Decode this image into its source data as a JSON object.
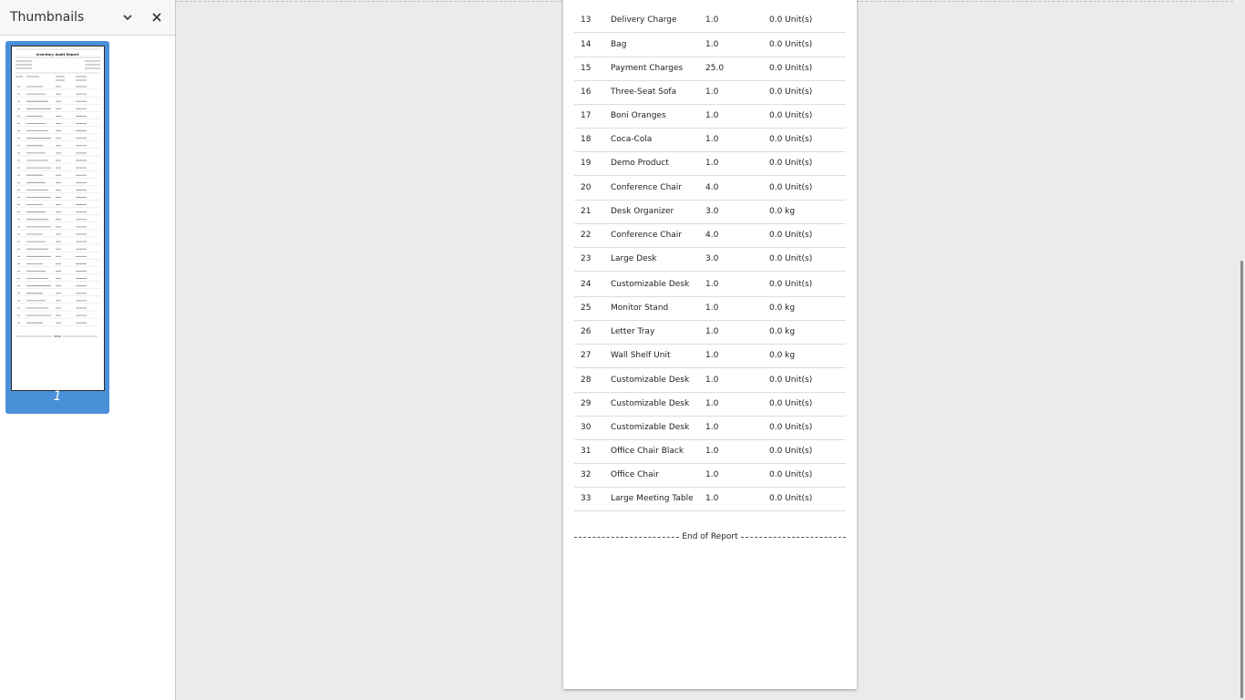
{
  "sidebar": {
    "title": "Thumbnails",
    "page_label": "1",
    "thumbnail_title": "Inventory Audit Report"
  },
  "report": {
    "rows": [
      {
        "no": "13",
        "product": "Delivery Charge",
        "qty": "1.0",
        "counted": "0.0 Unit(s)"
      },
      {
        "no": "14",
        "product": "Bag",
        "qty": "1.0",
        "counted": "0.0 Unit(s)"
      },
      {
        "no": "15",
        "product": "Payment Charges",
        "qty": "25.0",
        "counted": "0.0 Unit(s)"
      },
      {
        "no": "16",
        "product": "Three-Seat Sofa",
        "qty": "1.0",
        "counted": "0.0 Unit(s)"
      },
      {
        "no": "17",
        "product": "Boni Oranges",
        "qty": "1.0",
        "counted": "0.0 Unit(s)"
      },
      {
        "no": "18",
        "product": "Coca-Cola",
        "qty": "1.0",
        "counted": "0.0 Unit(s)"
      },
      {
        "no": "19",
        "product": "Demo Product",
        "qty": "1.0",
        "counted": "0.0 Unit(s)"
      },
      {
        "no": "20",
        "product": "Conference Chair",
        "qty": "4.0",
        "counted": "0.0 Unit(s)"
      },
      {
        "no": "21",
        "product": "Desk Organizer",
        "qty": "3.0",
        "counted": "0.0 kg"
      },
      {
        "no": "22",
        "product": "Conference Chair",
        "qty": "4.0",
        "counted": "0.0 Unit(s)"
      },
      {
        "no": "23",
        "product": "Large Desk",
        "qty": "3.0",
        "counted": "0.0 Unit(s)"
      },
      {
        "no": "24",
        "product": "Customizable Desk",
        "qty": "1.0",
        "counted": "0.0 Unit(s)"
      },
      {
        "no": "25",
        "product": "Monitor Stand",
        "qty": "1.0",
        "counted": "0.0 kg"
      },
      {
        "no": "26",
        "product": "Letter Tray",
        "qty": "1.0",
        "counted": "0.0 kg"
      },
      {
        "no": "27",
        "product": "Wall Shelf Unit",
        "qty": "1.0",
        "counted": "0.0 kg"
      },
      {
        "no": "28",
        "product": "Customizable Desk",
        "qty": "1.0",
        "counted": "0.0 Unit(s)"
      },
      {
        "no": "29",
        "product": "Customizable Desk",
        "qty": "1.0",
        "counted": "0.0 Unit(s)"
      },
      {
        "no": "30",
        "product": "Customizable Desk",
        "qty": "1.0",
        "counted": "0.0 Unit(s)"
      },
      {
        "no": "31",
        "product": "Office Chair Black",
        "qty": "1.0",
        "counted": "0.0 Unit(s)"
      },
      {
        "no": "32",
        "product": "Office Chair",
        "qty": "1.0",
        "counted": "0.0 Unit(s)"
      },
      {
        "no": "33",
        "product": "Large Meeting Table",
        "qty": "1.0",
        "counted": "0.0 Unit(s)"
      }
    ],
    "end_text": "End of Report"
  },
  "colors": {
    "accent": "#4a90d9",
    "viewer_bg": "#ebebeb"
  }
}
